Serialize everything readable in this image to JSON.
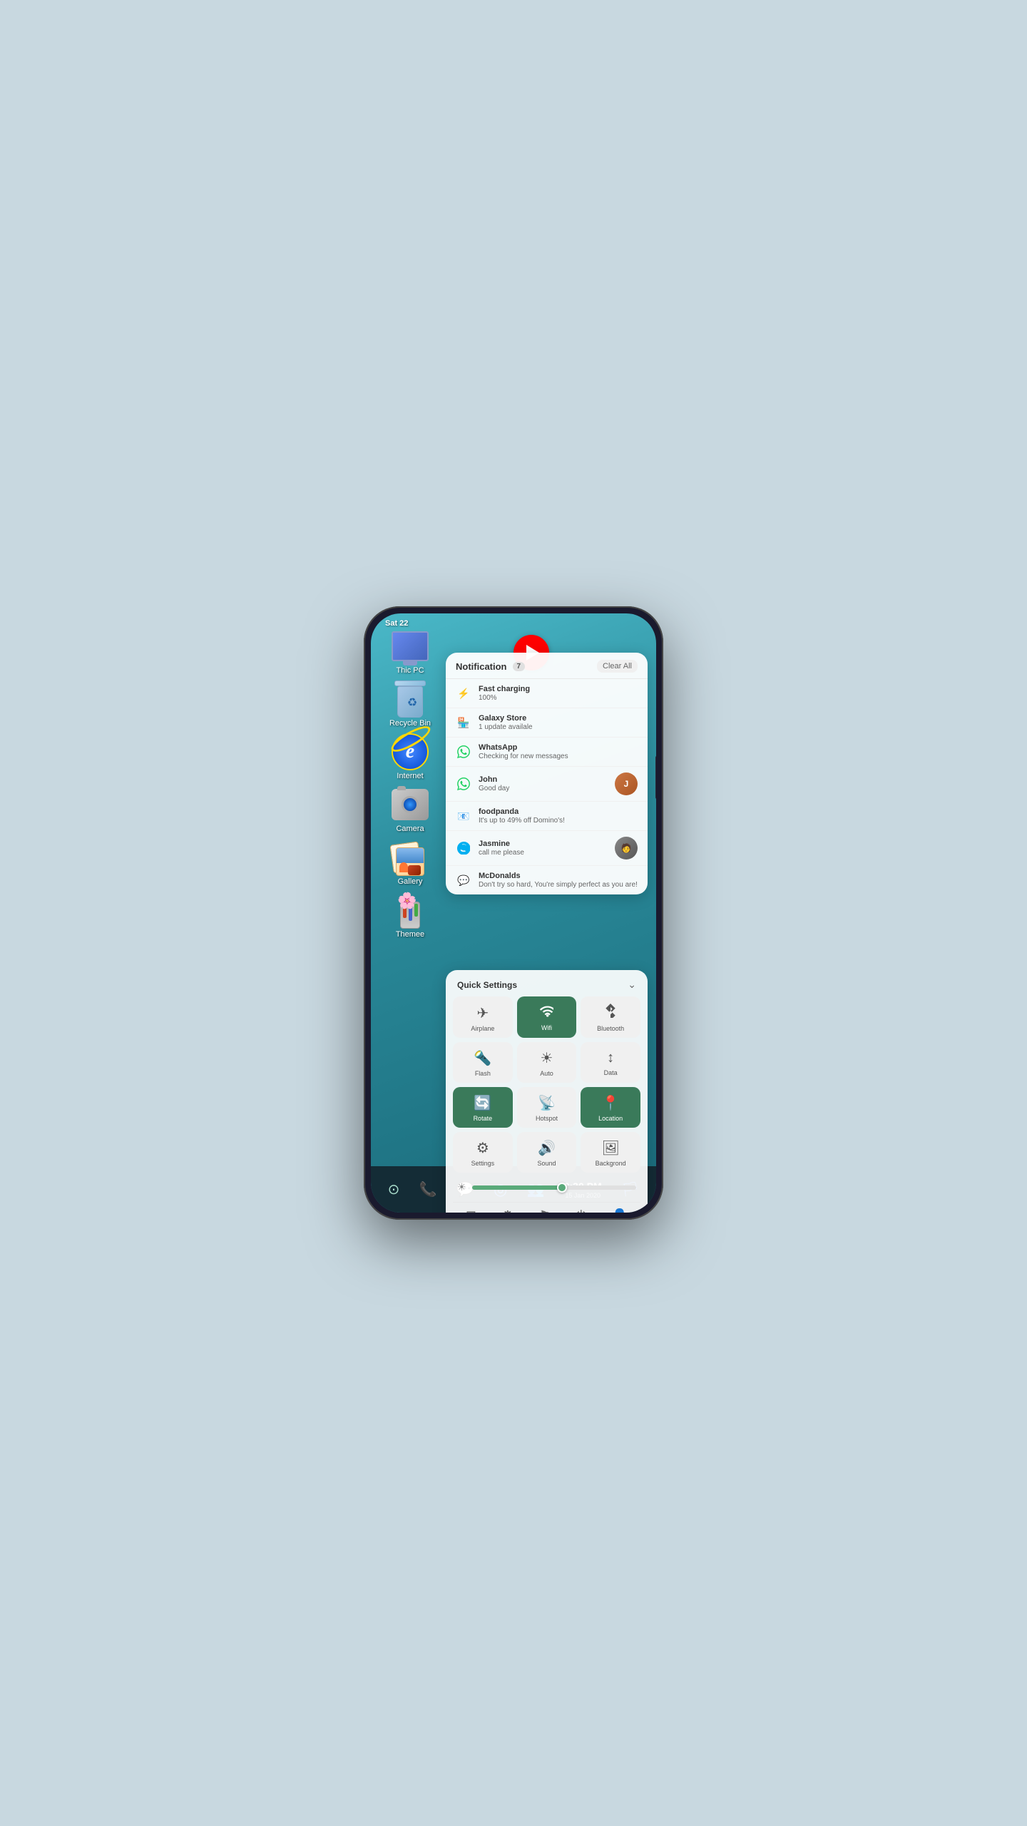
{
  "phone": {
    "status_date": "Sat 22",
    "bottom_time": "9:30 PM",
    "bottom_date": "15 Jan  2020"
  },
  "notifications": {
    "title": "Notification",
    "count": "7",
    "clear_all": "Clear All",
    "items": [
      {
        "app": "Fast charging",
        "msg": "100%",
        "icon": "⚡",
        "has_avatar": false
      },
      {
        "app": "Galaxy Store",
        "msg": "1 update availale",
        "icon": "🏪",
        "has_avatar": false
      },
      {
        "app": "WhatsApp",
        "msg": "Checking for new messages",
        "icon": "wa",
        "has_avatar": false
      },
      {
        "app": "John",
        "msg": "Good day",
        "icon": "wa",
        "has_avatar": true,
        "avatar_type": "john"
      },
      {
        "app": "foodpanda",
        "msg": "It's up to 49% off Domino's!",
        "icon": "📧",
        "has_avatar": false
      },
      {
        "app": "Jasmine",
        "msg": "call me please",
        "icon": "sk",
        "has_avatar": true,
        "avatar_type": "jasmine"
      },
      {
        "app": "McDonalds",
        "msg": "Don't try so hard, You're simply perfect as you are!",
        "icon": "💬",
        "has_avatar": false
      }
    ]
  },
  "quick_settings": {
    "title": "Quick Settings",
    "tiles": [
      {
        "label": "Airplane",
        "icon": "✈",
        "active": false
      },
      {
        "label": "Wifi",
        "icon": "📶",
        "active": true
      },
      {
        "label": "Bluetooth",
        "icon": "⧖",
        "active": false
      },
      {
        "label": "Flash",
        "icon": "🔦",
        "active": false
      },
      {
        "label": "Auto",
        "icon": "☀",
        "active": false
      },
      {
        "label": "Data",
        "icon": "↕",
        "active": false
      },
      {
        "label": "Rotate",
        "icon": "🔄",
        "active": true
      },
      {
        "label": "Hotspot",
        "icon": "📡",
        "active": false
      },
      {
        "label": "Location",
        "icon": "📍",
        "active": true
      },
      {
        "label": "Settings",
        "icon": "⚙",
        "active": false
      },
      {
        "label": "Sound",
        "icon": "🔊",
        "active": false
      },
      {
        "label": "Backgrond",
        "icon": "🖼",
        "active": false
      }
    ],
    "brightness_pct": 55
  },
  "desktop_icons": [
    {
      "label": "Thic PC",
      "type": "monitor"
    },
    {
      "label": "Recycle Bin",
      "type": "recycle"
    },
    {
      "label": "Internet",
      "type": "ie"
    },
    {
      "label": "Camera",
      "type": "camera"
    },
    {
      "label": "Gallery",
      "type": "gallery"
    },
    {
      "label": "Themee",
      "type": "themee"
    }
  ],
  "bottom_nav": {
    "icons": [
      "⊙",
      "📞",
      "💬",
      "◎",
      "👥",
      "⬆"
    ]
  }
}
